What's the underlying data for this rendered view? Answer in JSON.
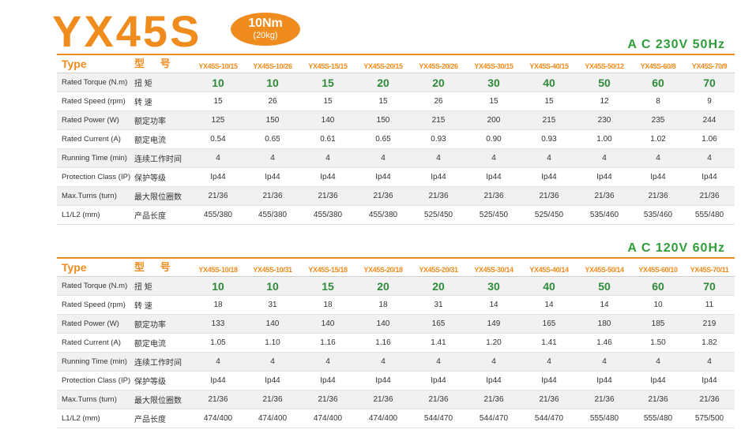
{
  "title": "YX45S",
  "badge": {
    "torque": "10Nm",
    "weight": "(20kg)"
  },
  "tables": [
    {
      "power": "A C  230V 50Hz",
      "header": {
        "type": "Type",
        "type_cn": "型 号"
      },
      "models": [
        "YX45S-10/15",
        "YX45S-10/26",
        "YX45S-15/15",
        "YX45S-20/15",
        "YX45S-20/26",
        "YX45S-30/15",
        "YX45S-40/15",
        "YX45S-50/12",
        "YX45S-60/8",
        "YX45S-70/9"
      ],
      "rows": [
        {
          "en": "Rated Torque (N.m)",
          "cn": "扭  矩",
          "values": [
            "10",
            "10",
            "15",
            "20",
            "20",
            "30",
            "40",
            "50",
            "60",
            "70"
          ]
        },
        {
          "en": "Rated Speed (rpm)",
          "cn": "转  速",
          "values": [
            "15",
            "26",
            "15",
            "15",
            "26",
            "15",
            "15",
            "12",
            "8",
            "9"
          ]
        },
        {
          "en": "Rated Power (W)",
          "cn": "额定功率",
          "values": [
            "125",
            "150",
            "140",
            "150",
            "215",
            "200",
            "215",
            "230",
            "235",
            "244"
          ]
        },
        {
          "en": "Rated Current (A)",
          "cn": "额定电流",
          "values": [
            "0.54",
            "0.65",
            "0.61",
            "0.65",
            "0.93",
            "0.90",
            "0.93",
            "1.00",
            "1.02",
            "1.06"
          ]
        },
        {
          "en": "Running Time (min)",
          "cn": "连续工作时间",
          "values": [
            "4",
            "4",
            "4",
            "4",
            "4",
            "4",
            "4",
            "4",
            "4",
            "4"
          ]
        },
        {
          "en": "Protection Class (IP)",
          "cn": "保护等级",
          "values": [
            "Ip44",
            "Ip44",
            "Ip44",
            "Ip44",
            "Ip44",
            "Ip44",
            "Ip44",
            "Ip44",
            "Ip44",
            "Ip44"
          ]
        },
        {
          "en": "Max.Turns (turn)",
          "cn": "最大限位圈数",
          "values": [
            "21/36",
            "21/36",
            "21/36",
            "21/36",
            "21/36",
            "21/36",
            "21/36",
            "21/36",
            "21/36",
            "21/36"
          ]
        },
        {
          "en": "L1/L2 (mm)",
          "cn": "产品长度",
          "values": [
            "455/380",
            "455/380",
            "455/380",
            "455/380",
            "525/450",
            "525/450",
            "525/450",
            "535/460",
            "535/460",
            "555/480"
          ]
        }
      ]
    },
    {
      "power": "A C  120V 60Hz",
      "header": {
        "type": "Type",
        "type_cn": "型 号"
      },
      "models": [
        "YX45S-10/18",
        "YX45S-10/31",
        "YX45S-15/18",
        "YX45S-20/18",
        "YX45S-20/31",
        "YX45S-30/14",
        "YX45S-40/14",
        "YX45S-50/14",
        "YX45S-60/10",
        "YX45S-70/11"
      ],
      "rows": [
        {
          "en": "Rated Torque (N.m)",
          "cn": "扭  矩",
          "values": [
            "10",
            "10",
            "15",
            "20",
            "20",
            "30",
            "40",
            "50",
            "60",
            "70"
          ]
        },
        {
          "en": "Rated Speed (rpm)",
          "cn": "转  速",
          "values": [
            "18",
            "31",
            "18",
            "18",
            "31",
            "14",
            "14",
            "14",
            "10",
            "11"
          ]
        },
        {
          "en": "Rated Power (W)",
          "cn": "额定功率",
          "values": [
            "133",
            "140",
            "140",
            "140",
            "165",
            "149",
            "165",
            "180",
            "185",
            "219"
          ]
        },
        {
          "en": "Rated Current (A)",
          "cn": "额定电流",
          "values": [
            "1.05",
            "1.10",
            "1.16",
            "1.16",
            "1.41",
            "1.20",
            "1.41",
            "1.46",
            "1.50",
            "1.82"
          ]
        },
        {
          "en": "Running Time (min)",
          "cn": "连续工作时间",
          "values": [
            "4",
            "4",
            "4",
            "4",
            "4",
            "4",
            "4",
            "4",
            "4",
            "4"
          ]
        },
        {
          "en": "Protection Class (IP)",
          "cn": "保护等级",
          "values": [
            "Ip44",
            "Ip44",
            "Ip44",
            "Ip44",
            "Ip44",
            "Ip44",
            "Ip44",
            "Ip44",
            "Ip44",
            "Ip44"
          ]
        },
        {
          "en": "Max.Turns (turn)",
          "cn": "最大限位圈数",
          "values": [
            "21/36",
            "21/36",
            "21/36",
            "21/36",
            "21/36",
            "21/36",
            "21/36",
            "21/36",
            "21/36",
            "21/36"
          ]
        },
        {
          "en": "L1/L2 (mm)",
          "cn": "产品长度",
          "values": [
            "474/400",
            "474/400",
            "474/400",
            "474/400",
            "544/470",
            "544/470",
            "544/470",
            "555/480",
            "555/480",
            "575/500"
          ]
        }
      ]
    }
  ],
  "colors": {
    "accent_orange": "#f08c1e",
    "accent_green": "#2f9e3a",
    "row_alt": "#f1f1f1"
  }
}
